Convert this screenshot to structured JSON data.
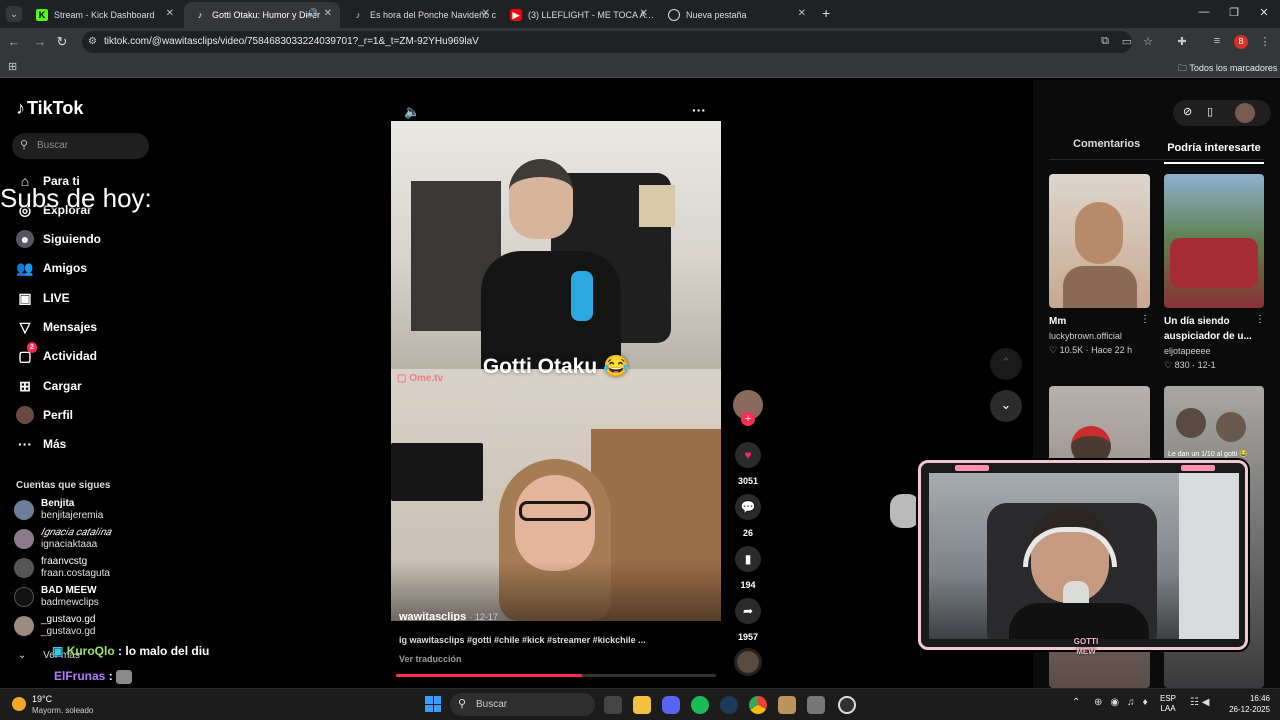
{
  "browser": {
    "tabs": [
      {
        "label": "Stream - Kick Dashboard",
        "icon": "kick-icon",
        "active": false
      },
      {
        "label": "Gotti Otaku: Humor y Diver",
        "icon": "tiktok-icon",
        "active": true
      },
      {
        "label": "Es hora del Ponche Navideño c",
        "icon": "tiktok-icon",
        "active": false
      },
      {
        "label": "(3) LLEFLIGHT - ME TOCA A MÍ",
        "icon": "youtube-icon",
        "active": false
      },
      {
        "label": "Nueva pestaña",
        "icon": "chrome-icon",
        "active": false
      }
    ],
    "url": "tiktok.com/@wawitasclips/video/7584683033224039701?_r=1&_t=ZM-92YHu969laV",
    "bookmarks_label": "Todos los marcadores",
    "profile_letter": "B"
  },
  "tiktok": {
    "logo": "TikTok",
    "search_placeholder": "Buscar",
    "nav": [
      {
        "label": "Para ti",
        "icon": "home-icon"
      },
      {
        "label": "Explorar",
        "icon": "compass-icon"
      },
      {
        "label": "Siguiendo",
        "icon": "following-icon"
      },
      {
        "label": "Amigos",
        "icon": "friends-icon"
      },
      {
        "label": "LIVE",
        "icon": "live-icon"
      },
      {
        "label": "Mensajes",
        "icon": "messages-icon"
      },
      {
        "label": "Actividad",
        "icon": "activity-icon",
        "badge": "2"
      },
      {
        "label": "Cargar",
        "icon": "upload-icon"
      },
      {
        "label": "Perfil",
        "icon": "profile-icon"
      },
      {
        "label": "Más",
        "icon": "more-icon"
      }
    ],
    "following_header": "Cuentas que sigues",
    "following": [
      {
        "name": "Benjita",
        "handle": "benjitajeremia"
      },
      {
        "name": "𝐼𝑔𝑛𝑎𝑐𝑖𝑎 𝑐𝑎𝑡𝑎𝑙𝑖𝑛𝑎",
        "handle": "ignaciaktaaa"
      },
      {
        "name": "fraanvcstg",
        "handle": "fraan.costaguta"
      },
      {
        "name": "BAD MEEW",
        "handle": "badmewclips"
      },
      {
        "name": "_gustavo.gd",
        "handle": "_gustavo.gd"
      }
    ],
    "see_more": "Ver más",
    "video": {
      "caption_overlay": "Gotti Otaku 😂",
      "author": "wawitasclips",
      "date": "· 12-17",
      "description": "ig wawitasclips #gotti #chile #kick #streamer #kickchile ...",
      "translate": "Ver traducción",
      "progress": 0.58
    },
    "actions": {
      "likes": "3051",
      "comments": "26",
      "saves": "194",
      "shares": "1957"
    },
    "right_tabs": {
      "comments": "Comentarios",
      "recommended": "Podría interesarte"
    },
    "recommended": [
      {
        "title": "Mm",
        "author": "luckybrown.official",
        "likes": "10.5K",
        "date": "· Hace 22 h"
      },
      {
        "title": "Un día siendo auspiciador de u...",
        "author": "eljotapeeee",
        "likes": "830",
        "date": "· 12-1"
      },
      {
        "title": "",
        "author": "",
        "likes": "",
        "date": ""
      },
      {
        "title": "Le dan un 1/10 al gotti 😂",
        "author": "",
        "likes": "",
        "date": ""
      }
    ]
  },
  "stream_overlay": {
    "subs_title": "Subs de hoy:",
    "chat": [
      {
        "user": "KuroQlo",
        "sep": " : ",
        "message": "lo malo del diu",
        "color": "#9be36b"
      },
      {
        "user": "ElFrunas",
        "sep": " : ",
        "message": "",
        "color": "#b57bff"
      }
    ],
    "webcam_logo": "GOTTI MEW"
  },
  "taskbar": {
    "weather_temp": "19°C",
    "weather_desc": "Mayorm. soleado",
    "search": "Buscar",
    "lang": "ESP",
    "lang_sub": "LAA",
    "time": "16:46",
    "date": "26-12-2025",
    "accent": "#fe2c55"
  }
}
